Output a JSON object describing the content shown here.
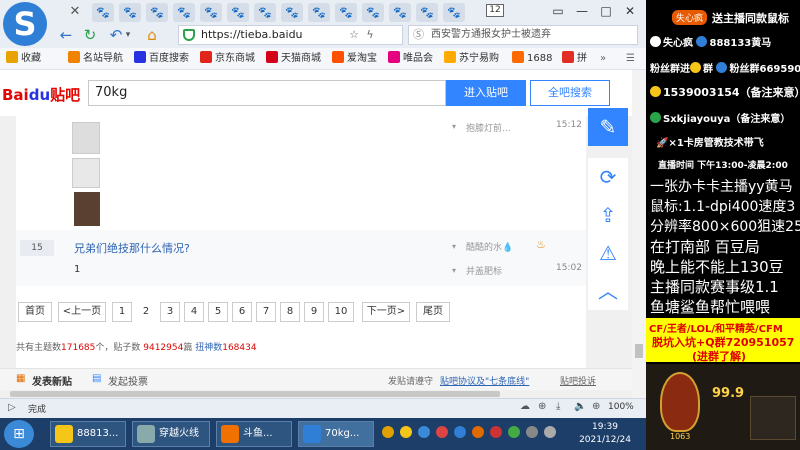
{
  "browser": {
    "logo_letter": "S",
    "tab_count": "12",
    "window_controls": [
      "▭",
      "—",
      "□",
      "✕"
    ],
    "url": "https://tieba.baidu",
    "search_placeholder": "西安警方通报女护士被遗弃",
    "bookmarks": [
      {
        "label": "收藏",
        "color": "#e8a300"
      },
      {
        "label": "名站导航",
        "color": "#f08300"
      },
      {
        "label": "百度搜索",
        "color": "#2932e1"
      },
      {
        "label": "京东商城",
        "color": "#e1251b"
      },
      {
        "label": "天猫商城",
        "color": "#d4001a"
      },
      {
        "label": "爱淘宝",
        "color": "#ff5000"
      },
      {
        "label": "唯品会",
        "color": "#e5007f"
      },
      {
        "label": "苏宁易购",
        "color": "#ffaa00"
      },
      {
        "label": "1688",
        "color": "#ff6a00"
      },
      {
        "label": "拼",
        "color": "#e02e24"
      }
    ],
    "status": "完成",
    "zoom": "100%"
  },
  "tieba": {
    "logo_bai": "Bai",
    "logo_du": "du",
    "logo_tieba": "贴吧",
    "keyword": "70kg",
    "enter_button": "进入贴吧",
    "search_all_button": "全吧搜索",
    "thread1": {
      "last_reply": "抱膝灯前...",
      "time": "15:12"
    },
    "thread2": {
      "reply_count": "15",
      "title": "兄弟们绝技那什么情况?",
      "author": "酷酷的水💧",
      "preview": "1",
      "last_reply": "并盖肥标",
      "time": "15:02"
    },
    "pagination": [
      "首页",
      "<上一页",
      "1",
      "2",
      "3",
      "4",
      "5",
      "6",
      "7",
      "8",
      "9",
      "10",
      "下一页>",
      "尾页"
    ],
    "stats": {
      "prefix": "共有主题数",
      "topics": "171685",
      "unit1": "个，贴子数 ",
      "posts": "9412954",
      "unit2": "篇 ",
      "fans_label": "扭神数",
      "fans": "168434"
    },
    "post_new": "发表新贴",
    "post_vote": "发起投票",
    "notice": "发贴请遵守",
    "notice_link": "贴吧协议及\"七条底线\"",
    "report": "贴吧投诉"
  },
  "taskbar": {
    "items": [
      {
        "label": "88813...",
        "color": "#f5c518"
      },
      {
        "label": "穿越火线",
        "color": "#8aa"
      },
      {
        "label": "斗鱼...",
        "color": "#f07000"
      },
      {
        "label": "70kg...",
        "color": "#2f7fd6"
      }
    ],
    "time": "19:39",
    "date": "2021/12/24"
  },
  "overlay": {
    "streamer_badge": "失心疯",
    "line1": "送主播同款鼠标",
    "line2_name": "失心疯",
    "line2_id": "888133黄马",
    "fan_group1": "粉丝群进",
    "fan_group2": "群",
    "fan_group3": "粉丝群6695903",
    "phone": "1539003154（备注来意）",
    "wechat": "Sxkjiayouya（备注来意）",
    "promo": "×1卡房管教技术带飞",
    "schedule": "直播时间 下午13:00-凌晨2:00",
    "l1": "一张办卡卡主播yy黄马",
    "l2": "鼠标:1.1-dpi400速度3",
    "l3": "分辨率800×600狙速25",
    "l4": "在打南部 百豆局",
    "l5": "晚上能不能上130豆",
    "l6": "主播同款赛事级1.1",
    "l7": "鱼塘鲨鱼帮忙喂喂",
    "banner1": "CF/王者/LOL/和平精英/CFM",
    "banner2": "脱坑入坑+Q群720951057",
    "banner3": "(进群了解)",
    "game_pct": "99.9",
    "game_level": "1063"
  }
}
